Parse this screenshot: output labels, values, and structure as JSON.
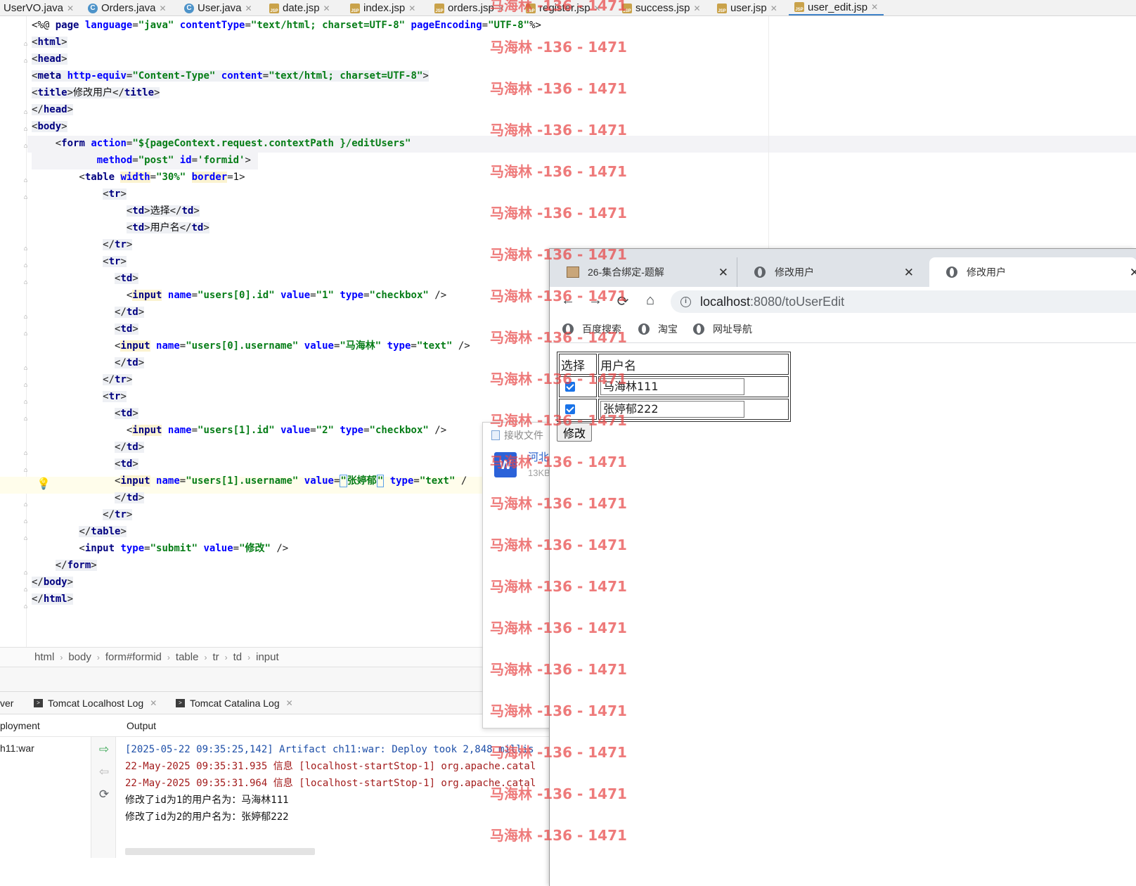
{
  "editor_tabs": [
    {
      "label": "UserVO.java",
      "type": "java"
    },
    {
      "label": "Orders.java",
      "type": "java"
    },
    {
      "label": "User.java",
      "type": "java"
    },
    {
      "label": "date.jsp",
      "type": "jsp"
    },
    {
      "label": "index.jsp",
      "type": "jsp"
    },
    {
      "label": "orders.jsp",
      "type": "jsp"
    },
    {
      "label": "register.jsp",
      "type": "jsp"
    },
    {
      "label": "success.jsp",
      "type": "jsp"
    },
    {
      "label": "user.jsp",
      "type": "jsp"
    },
    {
      "label": "user_edit.jsp",
      "type": "jsp",
      "active": true
    }
  ],
  "code": {
    "line1": {
      "open": "<%@ ",
      "kw": "page",
      "a1": "language",
      "v1": "\"java\"",
      "a2": "contentType",
      "v2": "\"text/html; charset=UTF-8\"",
      "a3": "pageEncoding",
      "v3": "\"UTF-8\"",
      "close": "%>"
    },
    "html_open": "html",
    "head_open": "head",
    "meta": {
      "tag": "meta",
      "a1": "http-equiv",
      "v1": "\"Content-Type\"",
      "a2": "content",
      "v2": "\"text/html; charset=UTF-8\""
    },
    "title": {
      "tag": "title",
      "text": "修改用户"
    },
    "head_close": "head",
    "body_open": "body",
    "form_open": {
      "tag": "form",
      "a1": "action",
      "v1": "\"${pageContext.request.contextPath }/editUsers\"",
      "a2": "method",
      "v2": "\"post\"",
      "a3": "id",
      "v3": "'formid'"
    },
    "table_open": {
      "tag": "table",
      "a1": "width",
      "v1": "\"30%\"",
      "a2": "border",
      "v2": "1"
    },
    "tr": "tr",
    "td": "td",
    "header_cells": [
      "选择",
      "用户名"
    ],
    "input_tag": "input",
    "rows": [
      {
        "id_name": "\"users[0].id\"",
        "id_value": "\"1\"",
        "user_name": "\"users[0].username\"",
        "user_value": "\"马海林\""
      },
      {
        "id_name": "\"users[1].id\"",
        "id_value": "\"2\"",
        "user_name": "\"users[1].username\"",
        "user_value": "张婷郁"
      }
    ],
    "attr_name": "name",
    "attr_value": "value",
    "attr_type": "type",
    "type_checkbox": "\"checkbox\"",
    "type_text": "\"text\"",
    "type_submit": "\"submit\"",
    "submit_value": "\"修改\"",
    "table_close": "table",
    "form_close": "form",
    "body_close": "body",
    "html_close": "html"
  },
  "breadcrumb": [
    "html",
    "body",
    "form#formid",
    "table",
    "tr",
    "td",
    "input"
  ],
  "services": {
    "tabs": [
      {
        "label": "ver"
      },
      {
        "label": "Tomcat Localhost Log"
      },
      {
        "label": "Tomcat Catalina Log"
      }
    ],
    "col_left": "ployment",
    "col_output": "Output",
    "tree_item": "h11:war",
    "console": [
      {
        "text": "[2025-05-22 09:35:25,142] Artifact ch11:war: Deploy took 2,848 millis",
        "style": "blue"
      },
      {
        "text": "22-May-2025 09:35:31.935 信息 [localhost-startStop-1] org.apache.catal",
        "style": "red"
      },
      {
        "text": "22-May-2025 09:35:31.964 信息 [localhost-startStop-1] org.apache.catal",
        "style": "red"
      },
      {
        "text": "修改了id为1的用户名为：马海林111",
        "style": "dark"
      },
      {
        "text": "修改了id为2的用户名为：张婷郁222",
        "style": "dark"
      }
    ]
  },
  "notification": {
    "header": "接收文件",
    "file_name": "河北",
    "file_size": "13KB"
  },
  "browser": {
    "tabs": [
      {
        "label": "26-集合绑定-题解"
      },
      {
        "label": "修改用户"
      },
      {
        "label": "修改用户",
        "active": true
      }
    ],
    "url_host": "localhost",
    "url_path": ":8080/toUserEdit",
    "bookmarks": [
      "百度搜索",
      "淘宝",
      "网址导航"
    ],
    "table_headers": [
      "选择",
      "用户名"
    ],
    "rows": [
      {
        "checked": true,
        "username": "马海林111"
      },
      {
        "checked": true,
        "username": "张婷郁222"
      }
    ],
    "submit_label": "修改"
  },
  "watermark": "马海林 -136 - 1471"
}
